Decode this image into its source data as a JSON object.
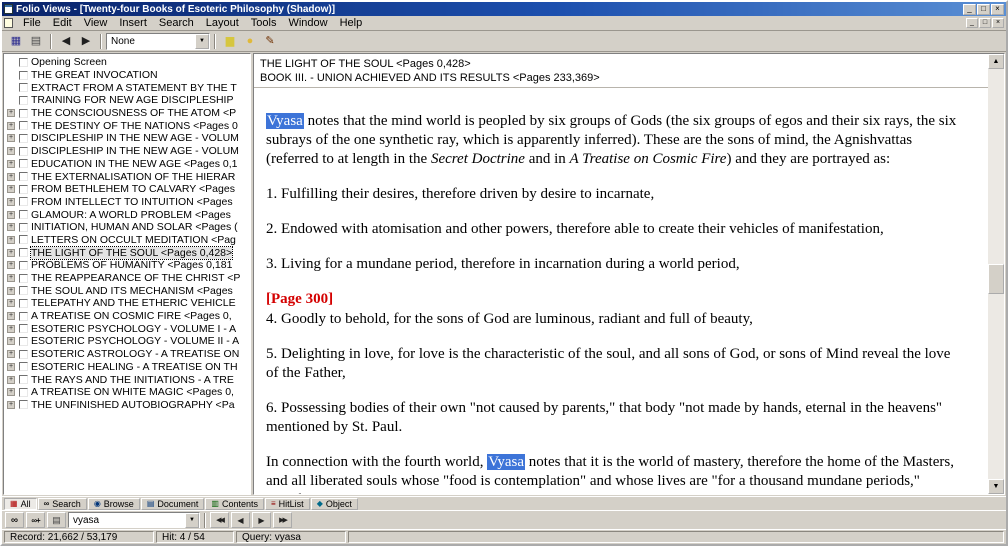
{
  "window": {
    "title": "Folio Views - [Twenty-four Books of Esoteric Philosophy (Shadow)]",
    "menu": [
      "File",
      "Edit",
      "View",
      "Insert",
      "Search",
      "Layout",
      "Tools",
      "Window",
      "Help"
    ]
  },
  "toolbar": {
    "left_icons": [
      "save-icon",
      "print-icon"
    ],
    "nav_icons": [
      "back-icon",
      "forward-icon"
    ],
    "combo_value": "None",
    "right_icons": [
      "highlighter-icon",
      "note-icon",
      "pen-icon"
    ]
  },
  "sidebar": {
    "selected_index": 15,
    "items": [
      {
        "expand": false,
        "label": "Opening Screen"
      },
      {
        "expand": false,
        "label": "THE GREAT INVOCATION"
      },
      {
        "expand": false,
        "label": "EXTRACT FROM A STATEMENT BY THE T"
      },
      {
        "expand": false,
        "label": "TRAINING FOR NEW AGE DISCIPLESHIP"
      },
      {
        "expand": true,
        "label": "THE CONSCIOUSNESS OF THE ATOM <P"
      },
      {
        "expand": true,
        "label": "THE DESTINY OF THE NATIONS <Pages 0"
      },
      {
        "expand": true,
        "label": "DISCIPLESHIP IN THE NEW AGE - VOLUM"
      },
      {
        "expand": true,
        "label": "DISCIPLESHIP IN THE NEW AGE - VOLUM"
      },
      {
        "expand": true,
        "label": "EDUCATION IN THE NEW AGE <Pages 0,1"
      },
      {
        "expand": true,
        "label": "THE EXTERNALISATION OF THE HIERAR"
      },
      {
        "expand": true,
        "label": "FROM BETHLEHEM TO CALVARY <Pages"
      },
      {
        "expand": true,
        "label": "FROM INTELLECT TO INTUITION <Pages"
      },
      {
        "expand": true,
        "label": "GLAMOUR: A WORLD PROBLEM <Pages"
      },
      {
        "expand": true,
        "label": "INITIATION, HUMAN AND SOLAR <Pages ("
      },
      {
        "expand": true,
        "label": "LETTERS ON OCCULT MEDITATION <Pag"
      },
      {
        "expand": true,
        "label": "THE LIGHT OF THE SOUL <Pages 0,428>"
      },
      {
        "expand": true,
        "label": "PROBLEMS OF HUMANITY <Pages 0,181"
      },
      {
        "expand": true,
        "label": "THE REAPPEARANCE OF THE CHRIST <P"
      },
      {
        "expand": true,
        "label": "THE SOUL AND ITS MECHANISM <Pages"
      },
      {
        "expand": true,
        "label": "TELEPATHY AND THE ETHERIC VEHICLE"
      },
      {
        "expand": true,
        "label": "A TREATISE ON COSMIC FIRE <Pages 0,"
      },
      {
        "expand": true,
        "label": "ESOTERIC PSYCHOLOGY - VOLUME I - A"
      },
      {
        "expand": true,
        "label": "ESOTERIC PSYCHOLOGY - VOLUME II - A"
      },
      {
        "expand": true,
        "label": "ESOTERIC ASTROLOGY - A TREATISE ON"
      },
      {
        "expand": true,
        "label": "ESOTERIC HEALING - A TREATISE ON TH"
      },
      {
        "expand": true,
        "label": "THE RAYS AND THE INITIATIONS - A TRE"
      },
      {
        "expand": true,
        "label": "A TREATISE ON WHITE MAGIC <Pages 0,"
      },
      {
        "expand": true,
        "label": "THE UNFINISHED AUTOBIOGRAPHY <Pa"
      }
    ]
  },
  "content": {
    "header_line1": "THE LIGHT OF THE SOUL <Pages 0,428>",
    "header_line2": "BOOK III. - UNION ACHIEVED AND ITS RESULTS <Pages 233,369>",
    "paragraphs": [
      {
        "runs": [
          {
            "style": "hit",
            "text": "Vyasa"
          },
          {
            "style": "normal",
            "text": " notes that the mind world is peopled by six groups of Gods (the six groups of egos and their six rays, the six subrays of the one synthetic ray, which is apparently inferred).  These are the sons of mind, the Agnishvattas (referred to at length in the "
          },
          {
            "style": "italic",
            "text": "Secret Doctrine"
          },
          {
            "style": "normal",
            "text": " and in "
          },
          {
            "style": "italic",
            "text": "A Treatise on Cosmic Fire"
          },
          {
            "style": "normal",
            "text": ") and they are portrayed as:"
          }
        ]
      },
      {
        "runs": [
          {
            "style": "normal",
            "text": "1. Fulfilling their desires, therefore driven by desire to incarnate,"
          }
        ]
      },
      {
        "runs": [
          {
            "style": "normal",
            "text": " 2. Endowed with atomisation and other powers, therefore able to create their vehicles of manifestation,"
          }
        ]
      },
      {
        "runs": [
          {
            "style": "normal",
            "text": "3. Living for a mundane period, therefore in incarnation during a world period,"
          }
        ]
      },
      {
        "tight": true,
        "runs": [
          {
            "style": "red",
            "text": "[Page 300]"
          }
        ]
      },
      {
        "runs": [
          {
            "style": "normal",
            "text": "4. Goodly to behold, for the sons of God are luminous, radiant and full of beauty,"
          }
        ]
      },
      {
        "runs": [
          {
            "style": "normal",
            "text": "5. Delighting in love, for love is the characteristic of the soul, and all sons of God, or sons of Mind reveal the love of the Father,"
          }
        ]
      },
      {
        "runs": [
          {
            "style": "normal",
            "text": "6. Possessing bodies of their own \"not caused by parents,\" that body \"not made by hands, eternal in the heavens\" mentioned by St.  Paul."
          }
        ]
      },
      {
        "runs": [
          {
            "style": "normal",
            "text": "In connection with the fourth world, "
          },
          {
            "style": "hit",
            "text": "Vyasa"
          },
          {
            "style": "normal",
            "text": " notes that it is the world of mastery, therefore the home of the Masters, and all liberated souls whose \"food is contemplation\" and whose lives are \"for a thousand mundane periods,\" therefore who have immortality."
          }
        ]
      }
    ]
  },
  "tabs": [
    {
      "label": "All",
      "icon": "all-icon",
      "active": true
    },
    {
      "label": "Search",
      "icon": "search-icon",
      "active": false
    },
    {
      "label": "Browse",
      "icon": "browse-icon",
      "active": false
    },
    {
      "label": "Document",
      "icon": "document-icon",
      "active": false
    },
    {
      "label": "Contents",
      "icon": "contents-icon",
      "active": false
    },
    {
      "label": "HitList",
      "icon": "hitlist-icon",
      "active": false
    },
    {
      "label": "Object",
      "icon": "object-icon",
      "active": false
    }
  ],
  "querybar": {
    "left_icons": [
      "binoculars-icon",
      "advanced-query-icon",
      "word-wheel-icon"
    ],
    "query_value": "vyasa",
    "nav_icons": [
      "first-hit-icon",
      "previous-hit-icon",
      "next-hit-icon",
      "last-hit-icon"
    ]
  },
  "statusbar": {
    "record": "Record: 21,662 / 53,179",
    "hit": "Hit: 4 / 54",
    "query": "Query: vyasa"
  }
}
